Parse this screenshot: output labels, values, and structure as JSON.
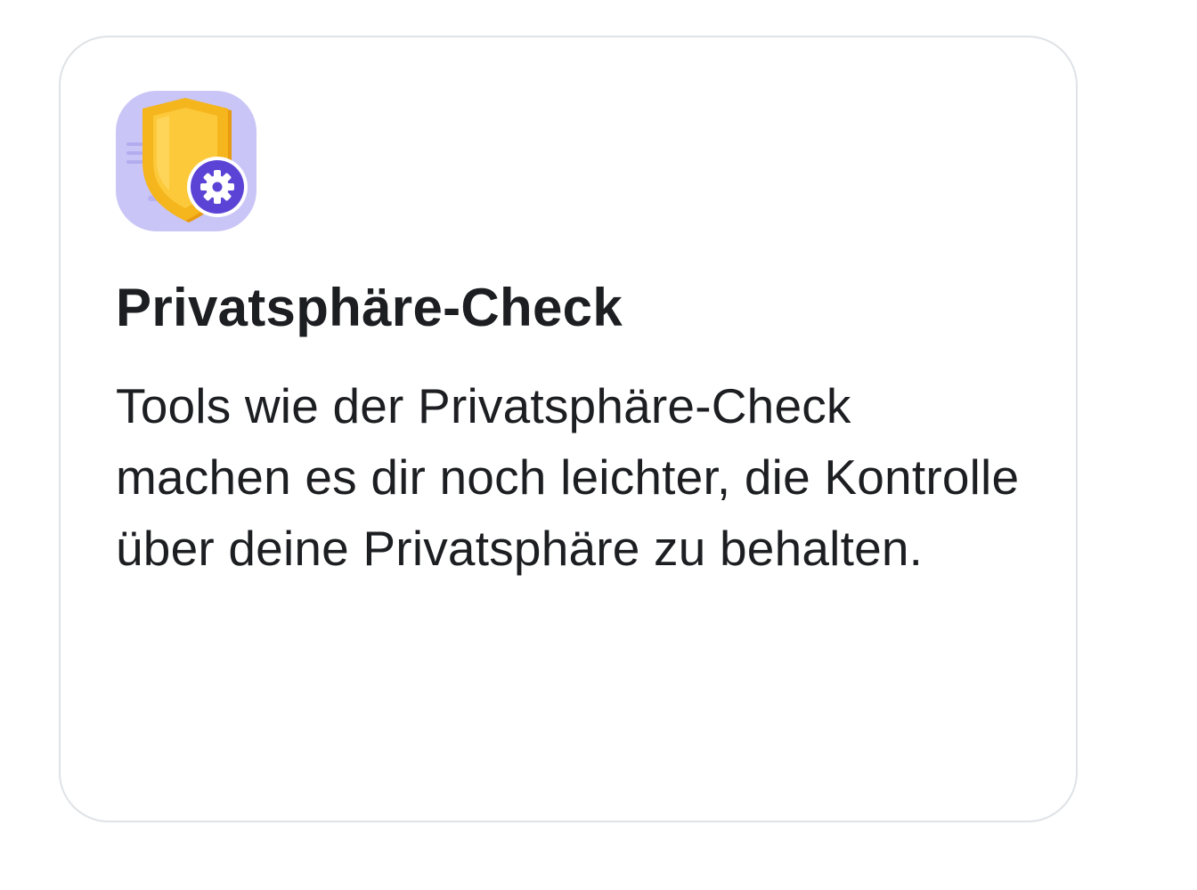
{
  "card": {
    "icon": "shield-gear-icon",
    "title": "Privatsphäre-Check",
    "description": "Tools wie der Privatsphäre-Check machen es dir noch leichter, die Kontrolle über deine Privatsphäre zu behalten."
  },
  "colors": {
    "icon_background": "#c9c5f6",
    "shield": "#f5b51c",
    "gear_badge": "#5b43d6",
    "text": "#1c1e21",
    "card_border": "#dfe2e6"
  }
}
